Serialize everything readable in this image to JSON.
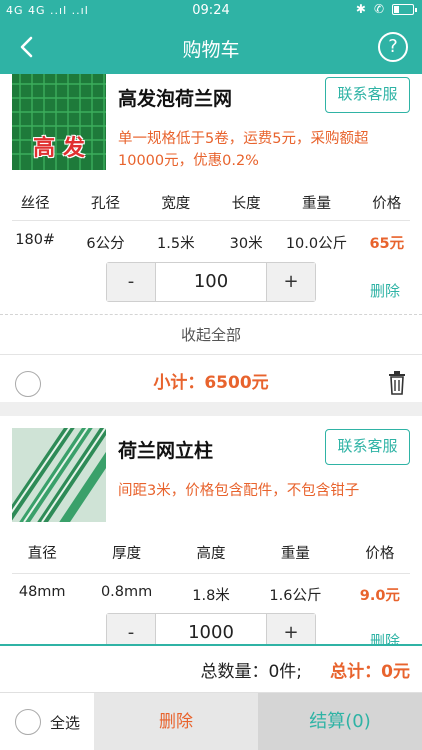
{
  "status": {
    "signal": "4G 4G ..ıl ..ıl",
    "time": "09:24"
  },
  "nav": {
    "title": "购物车",
    "help": "?"
  },
  "items": [
    {
      "name": "高发泡荷兰网",
      "thumb_text": "高 发",
      "service_label": "联系客服",
      "desc": "单一规格低于5卷，运费5元，采购额超10000元，优惠0.2%",
      "headers": [
        "丝径",
        "孔径",
        "宽度",
        "长度",
        "重量",
        "价格"
      ],
      "values": [
        "180#",
        "6公分",
        "1.5米",
        "30米",
        "10.0公斤",
        "65元"
      ],
      "qty": "100",
      "minus": "-",
      "plus": "+",
      "delete_label": "删除",
      "collapse_label": "收起全部",
      "subtotal": "小计：6500元"
    },
    {
      "name": "荷兰网立柱",
      "service_label": "联系客服",
      "desc": "间距3米，价格包含配件，不包含钳子",
      "headers": [
        "直径",
        "厚度",
        "高度",
        "重量",
        "价格"
      ],
      "values": [
        "48mm",
        "0.8mm",
        "1.8米",
        "1.6公斤",
        "9.0元"
      ],
      "qty": "1000",
      "minus": "-",
      "plus": "+",
      "delete_label": "删除"
    }
  ],
  "totals": {
    "quantity": "总数量：0件;",
    "total": "总计：0元"
  },
  "bottom": {
    "select_all": "全选",
    "delete": "删除",
    "checkout": "结算(0)"
  },
  "colors": {
    "accent": "#2fb3a5",
    "price": "#e8632d"
  }
}
